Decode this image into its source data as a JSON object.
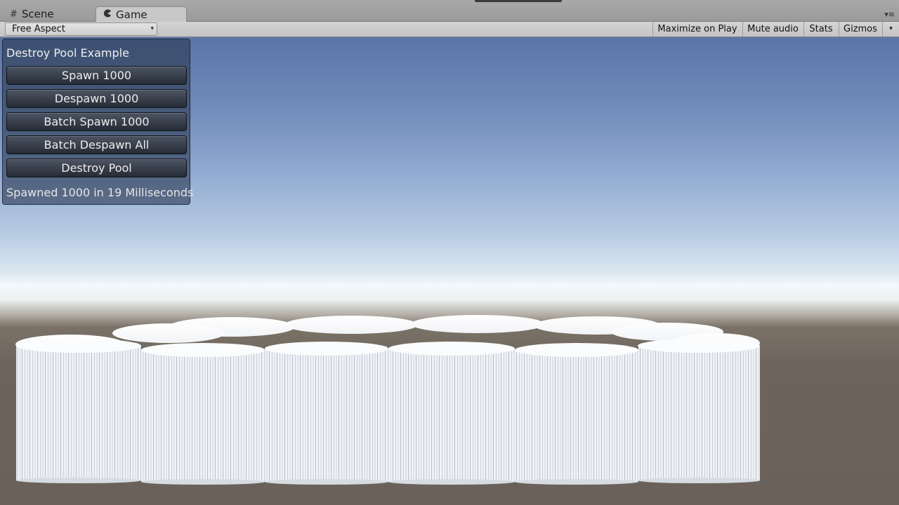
{
  "tabs": {
    "scene_label": "Scene",
    "game_label": "Game",
    "scene_icon": "grid-icon",
    "game_icon": "pacman-icon"
  },
  "toolbar": {
    "aspect_value": "Free Aspect",
    "maximize_label": "Maximize on Play",
    "mute_label": "Mute audio",
    "stats_label": "Stats",
    "gizmos_label": "Gizmos"
  },
  "game": {
    "panel": {
      "title": "Destroy Pool Example",
      "buttons": [
        {
          "label": "Spawn 1000"
        },
        {
          "label": "Despawn 1000"
        },
        {
          "label": "Batch Spawn 1000"
        },
        {
          "label": "Batch Despawn All"
        },
        {
          "label": "Destroy Pool"
        }
      ],
      "status": "Spawned 1000 in 19 Milliseconds"
    }
  },
  "colors": {
    "panel_bg": "#2c3a52",
    "button_bg": "#3a414e",
    "sky_top": "#5b75a8",
    "horizon": "#f2f8fb",
    "ground": "#6a625a"
  }
}
